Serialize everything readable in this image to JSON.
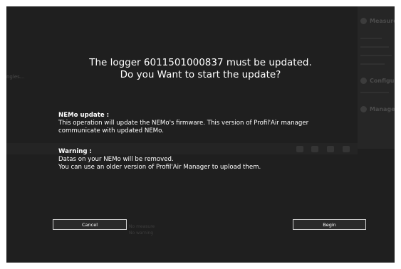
{
  "dialog": {
    "title_line1": "The logger 6011501000837 must be updated.",
    "title_line2": "Do you Want to start the update?",
    "nemo_heading": "NEMo update :",
    "nemo_text_line1": "This operation will update the NEMo's firmware. This version of Profil'Air manager",
    "nemo_text_line2": "communicate with updated NEMo.",
    "warning_heading": "Warning :",
    "warning_line1": "Datas on your NEMo will be removed.",
    "warning_line2": "You can use an older version of Profil'Air Manager to upload them.",
    "cancel_label": "Cancel",
    "begin_label": "Begin"
  },
  "background": {
    "left_label": "ngles...",
    "panel_headings": [
      "Measure",
      "Configu",
      "Manage"
    ],
    "bottom_line1": "No measure",
    "bottom_line2": "No warning"
  }
}
